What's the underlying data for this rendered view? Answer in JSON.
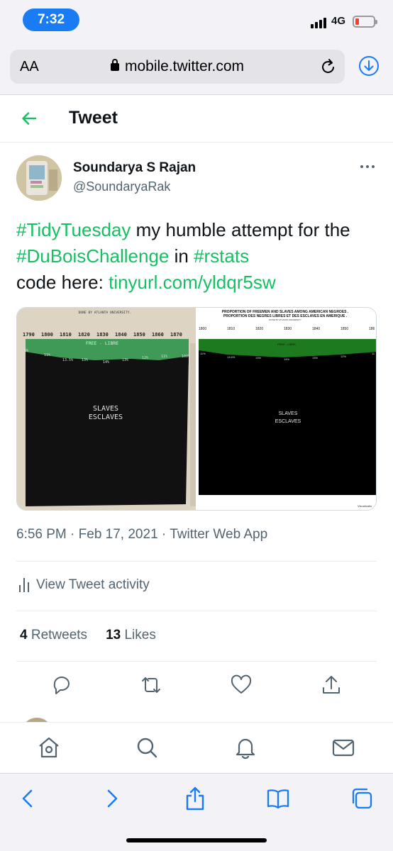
{
  "status_bar": {
    "time": "7:32",
    "network": "4G"
  },
  "browser": {
    "aa_label": "AA",
    "url": "mobile.twitter.com"
  },
  "header": {
    "title": "Tweet"
  },
  "author": {
    "name": "Soundarya S Rajan",
    "handle": "@SoundaryaRak"
  },
  "tweet": {
    "hashtag_1": "#TidyTuesday",
    "text_1": " my humble attempt for the ",
    "hashtag_2": "#DuBoisChallenge",
    "text_2": " in ",
    "hashtag_3": "#rstats",
    "text_3": "code here: ",
    "link": "tinyurl.com/yldqr5sw"
  },
  "media": {
    "left_header": "DONE BY ATLANTA UNIVERSITY.",
    "left_years": [
      "1790",
      "1800",
      "1810",
      "1820",
      "1830",
      "1840",
      "1850",
      "1860",
      "1870"
    ],
    "left_band_label": "FREE - LIBRE",
    "left_percents": [
      "8%",
      "11%",
      "13.5%",
      "13%",
      "14%",
      "13%",
      "12%",
      "11%",
      "100%"
    ],
    "left_main_label_1": "SLAVES",
    "left_main_label_2": "ESCLAVES",
    "right_title_1": "PROPORTION OF FREEMEN AND SLAVES AMONG AMERICAN NEGROES .",
    "right_title_2": "PROPORTION DES NEGRES LIBRES ET DES ESCLAVES EN AMERIQUE .",
    "right_subtitle": "DONE BY ATLANTA UNIVERSITY",
    "right_years": [
      "1800",
      "1810",
      "1820",
      "1830",
      "1840",
      "1850",
      "186"
    ],
    "right_band_label": "FREE - LIBRE",
    "right_percents": [
      "11%",
      "13.5%",
      "13%",
      "14%",
      "13%",
      "12%",
      "11"
    ],
    "right_main_label_1": "SLAVES",
    "right_main_label_2": "ESCLAVES",
    "right_credit": "Visualizatio"
  },
  "meta": {
    "time": "6:56 PM",
    "date": "Feb 17, 2021",
    "source": "Twitter Web App",
    "sep": " · "
  },
  "activity": {
    "label": "View Tweet activity"
  },
  "stats": {
    "retweets_count": "4",
    "retweets_label": "Retweets",
    "likes_count": "13",
    "likes_label": "Likes"
  },
  "colors": {
    "accent": "#17bf63",
    "safari_blue": "#1a7cf5",
    "muted": "#536471"
  },
  "icons": {
    "actions": [
      "reply-icon",
      "retweet-icon",
      "like-icon",
      "share-icon"
    ],
    "tw_nav": [
      "home-icon",
      "search-icon",
      "notifications-icon",
      "messages-icon"
    ],
    "safari": [
      "back-icon",
      "forward-icon",
      "share-icon",
      "bookmarks-icon",
      "tabs-icon"
    ]
  }
}
